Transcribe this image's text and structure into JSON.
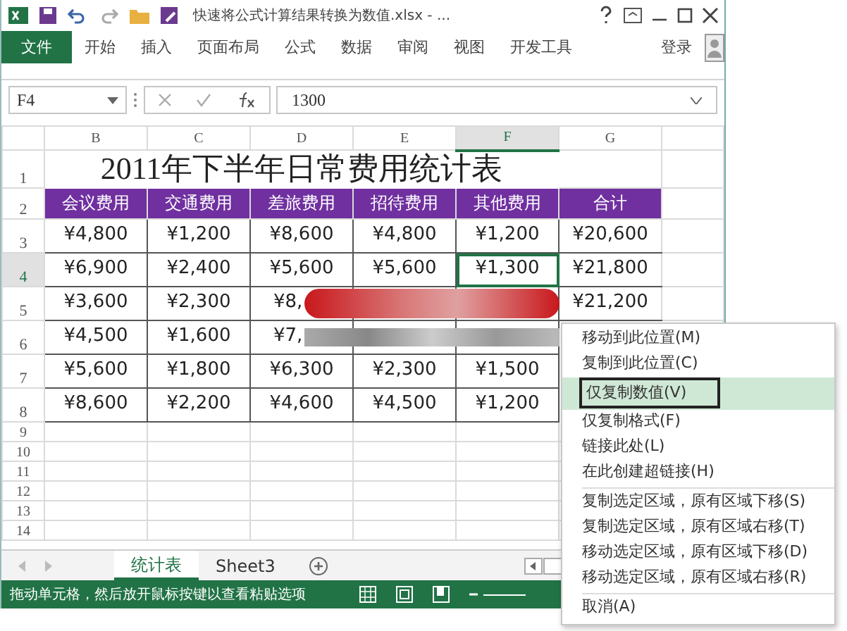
{
  "window": {
    "title": "快速将公式计算结果转换为数值.xlsx - ..."
  },
  "ribbon": {
    "tabs": [
      {
        "label": "文件",
        "selected": true
      },
      {
        "label": "开始",
        "selected": false
      },
      {
        "label": "插入",
        "selected": false
      },
      {
        "label": "页面布局",
        "selected": false
      },
      {
        "label": "公式",
        "selected": false
      },
      {
        "label": "数据",
        "selected": false
      },
      {
        "label": "审阅",
        "selected": false
      },
      {
        "label": "视图",
        "selected": false
      },
      {
        "label": "开发工具",
        "selected": false
      }
    ],
    "sign_in": "登录"
  },
  "formula_bar": {
    "name_box": "F4",
    "value": "1300"
  },
  "sheet": {
    "columns": [
      {
        "label": "B",
        "selected": false
      },
      {
        "label": "C",
        "selected": false
      },
      {
        "label": "D",
        "selected": false
      },
      {
        "label": "E",
        "selected": false
      },
      {
        "label": "F",
        "selected": true
      },
      {
        "label": "G",
        "selected": false
      }
    ],
    "title_row": {
      "number": "1",
      "text": "2011年下半年日常费用统计表"
    },
    "header_row": {
      "number": "2",
      "cells": [
        "会议费用",
        "交通费用",
        "差旅费用",
        "招待费用",
        "其他费用",
        "合计"
      ]
    },
    "data_rows": [
      {
        "number": "3",
        "selected": false,
        "cells": [
          "¥4,800",
          "¥1,200",
          "¥8,600",
          "¥4,800",
          "¥1,200",
          "¥20,600"
        ]
      },
      {
        "number": "4",
        "selected": true,
        "cells": [
          "¥6,900",
          "¥2,400",
          "¥5,600",
          "¥5,600",
          "¥1,300",
          "¥21,800"
        ]
      },
      {
        "number": "5",
        "selected": false,
        "cells": [
          "¥3,600",
          "¥2,300",
          "¥8,",
          "",
          "",
          "¥21,200"
        ]
      },
      {
        "number": "6",
        "selected": false,
        "cells": [
          "¥4,500",
          "¥1,600",
          "¥7,",
          "",
          "",
          ""
        ]
      },
      {
        "number": "7",
        "selected": false,
        "cells": [
          "¥5,600",
          "¥1,800",
          "¥6,300",
          "¥2,300",
          "¥1,500",
          ""
        ]
      },
      {
        "number": "8",
        "selected": false,
        "cells": [
          "¥8,600",
          "¥2,200",
          "¥4,600",
          "¥4,500",
          "¥1,200",
          ""
        ]
      }
    ],
    "empty_rows": [
      "9",
      "10",
      "11",
      "12",
      "13",
      "14"
    ]
  },
  "sheet_tabs": [
    {
      "label": "统计表",
      "selected": true
    },
    {
      "label": "Sheet3",
      "selected": false
    }
  ],
  "status_bar": {
    "message": "拖动单元格，然后放开鼠标按键以查看粘贴选项"
  },
  "context_menu": {
    "groups": [
      [
        {
          "label": "移动到此位置(M)",
          "selected": false
        },
        {
          "label": "复制到此位置(C)",
          "selected": false
        },
        {
          "label": "仅复制数值(V)",
          "selected": true
        },
        {
          "label": "仅复制格式(F)",
          "selected": false
        },
        {
          "label": "链接此处(L)",
          "selected": false
        },
        {
          "label": "在此创建超链接(H)",
          "selected": false
        }
      ],
      [
        {
          "label": "复制选定区域，原有区域下移(S)",
          "selected": false
        },
        {
          "label": "复制选定区域，原有区域右移(T)",
          "selected": false
        },
        {
          "label": "移动选定区域，原有区域下移(D)",
          "selected": false
        },
        {
          "label": "移动选定区域，原有区域右移(R)",
          "selected": false
        }
      ],
      [
        {
          "label": "取消(A)",
          "selected": false
        }
      ]
    ]
  }
}
